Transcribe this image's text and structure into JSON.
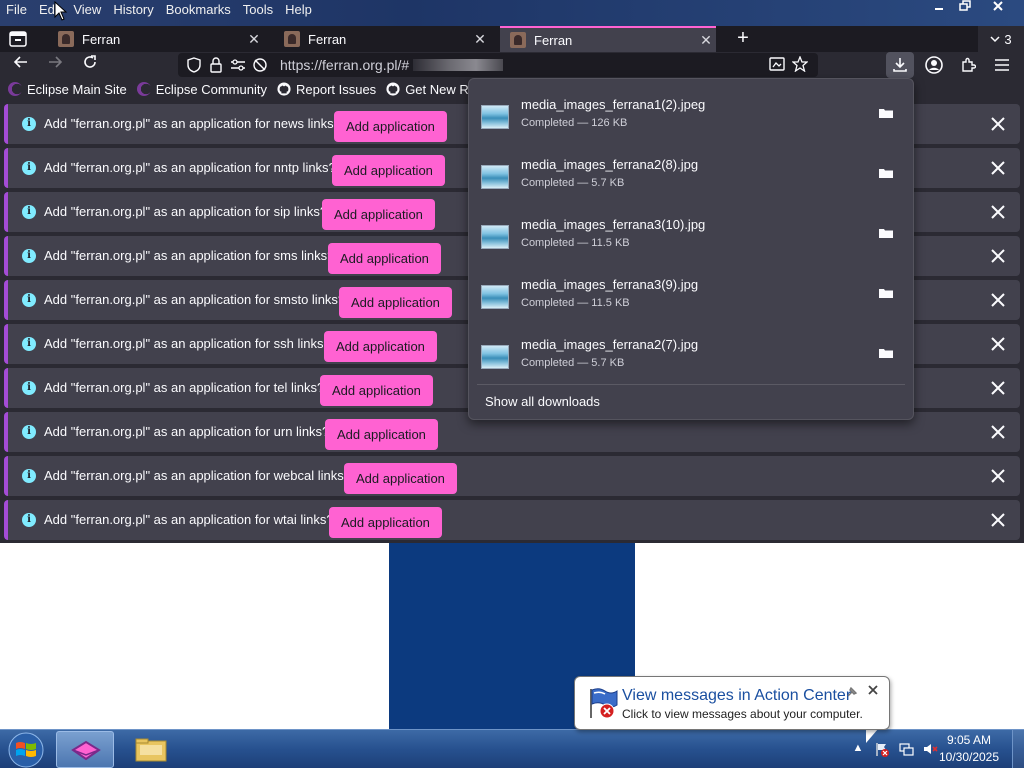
{
  "menubar": {
    "items": [
      {
        "label": "File",
        "mnemonic": "F"
      },
      {
        "label": "Edit",
        "mnemonic": "E"
      },
      {
        "label": "View",
        "mnemonic": "V"
      },
      {
        "label": "History",
        "mnemonic": "s"
      },
      {
        "label": "Bookmarks",
        "mnemonic": "B"
      },
      {
        "label": "Tools",
        "mnemonic": "T"
      },
      {
        "label": "Help",
        "mnemonic": "H"
      }
    ]
  },
  "tabs": [
    {
      "title": "Ferran",
      "active": false
    },
    {
      "title": "Ferran",
      "active": false
    },
    {
      "title": "Ferran",
      "active": true
    }
  ],
  "tab_count": "3",
  "urlbar": {
    "url": "https://ferran.org.pl/#"
  },
  "bookmarks": [
    {
      "label": "Eclipse Main Site",
      "icon": "eclipse-icon"
    },
    {
      "label": "Eclipse Community",
      "icon": "eclipse-icon"
    },
    {
      "label": "Report Issues",
      "icon": "github-icon"
    },
    {
      "label": "Get New Releases",
      "icon": "github-icon"
    }
  ],
  "notifications": [
    {
      "message": "Add \"ferran.org.pl\" as an application for news links?",
      "button": "Add application"
    },
    {
      "message": "Add \"ferran.org.pl\" as an application for nntp links?",
      "button": "Add application"
    },
    {
      "message": "Add \"ferran.org.pl\" as an application for sip links?",
      "button": "Add application"
    },
    {
      "message": "Add \"ferran.org.pl\" as an application for sms links?",
      "button": "Add application"
    },
    {
      "message": "Add \"ferran.org.pl\" as an application for smsto links?",
      "button": "Add application"
    },
    {
      "message": "Add \"ferran.org.pl\" as an application for ssh links?",
      "button": "Add application"
    },
    {
      "message": "Add \"ferran.org.pl\" as an application for tel links?",
      "button": "Add application"
    },
    {
      "message": "Add \"ferran.org.pl\" as an application for urn links?",
      "button": "Add application"
    },
    {
      "message": "Add \"ferran.org.pl\" as an application for webcal links?",
      "button": "Add application"
    },
    {
      "message": "Add \"ferran.org.pl\" as an application for wtai links?",
      "button": "Add application"
    }
  ],
  "downloads": {
    "items": [
      {
        "name": "media_images_ferrana1(2).jpeg",
        "status": "Completed — 126 KB"
      },
      {
        "name": "media_images_ferrana2(8).jpg",
        "status": "Completed — 5.7 KB"
      },
      {
        "name": "media_images_ferrana3(10).jpg",
        "status": "Completed — 11.5 KB"
      },
      {
        "name": "media_images_ferrana3(9).jpg",
        "status": "Completed — 11.5 KB"
      },
      {
        "name": "media_images_ferrana2(7).jpg",
        "status": "Completed — 5.7 KB"
      }
    ],
    "show_all": "Show all downloads"
  },
  "balloon": {
    "title": "View messages in Action Center",
    "text": "Click to view messages about your computer."
  },
  "clock": {
    "time": "9:05 AM",
    "date": "10/30/2025"
  },
  "colors": {
    "accent": "#ff62d2",
    "notification_border": "#a44cd6",
    "info_icon": "#80ebff",
    "toolbar_bg": "#2b2a33",
    "page_blue": "#0c3a7f"
  }
}
